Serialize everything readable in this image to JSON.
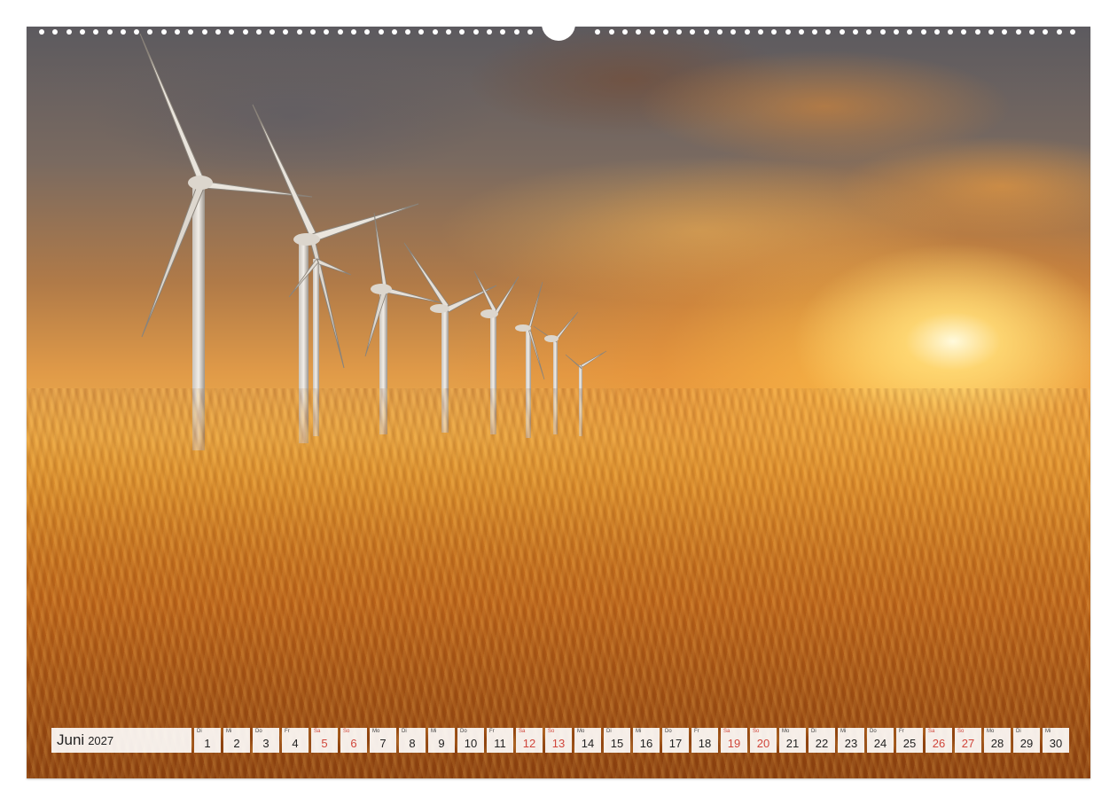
{
  "calendar": {
    "month": "Juni",
    "year": "2027",
    "days": [
      {
        "wd": "Di",
        "num": "1",
        "weekend": false
      },
      {
        "wd": "Mi",
        "num": "2",
        "weekend": false
      },
      {
        "wd": "Do",
        "num": "3",
        "weekend": false
      },
      {
        "wd": "Fr",
        "num": "4",
        "weekend": false
      },
      {
        "wd": "Sa",
        "num": "5",
        "weekend": true
      },
      {
        "wd": "So",
        "num": "6",
        "weekend": true
      },
      {
        "wd": "Mo",
        "num": "7",
        "weekend": false
      },
      {
        "wd": "Di",
        "num": "8",
        "weekend": false
      },
      {
        "wd": "Mi",
        "num": "9",
        "weekend": false
      },
      {
        "wd": "Do",
        "num": "10",
        "weekend": false
      },
      {
        "wd": "Fr",
        "num": "11",
        "weekend": false
      },
      {
        "wd": "Sa",
        "num": "12",
        "weekend": true
      },
      {
        "wd": "So",
        "num": "13",
        "weekend": true
      },
      {
        "wd": "Mo",
        "num": "14",
        "weekend": false
      },
      {
        "wd": "Di",
        "num": "15",
        "weekend": false
      },
      {
        "wd": "Mi",
        "num": "16",
        "weekend": false
      },
      {
        "wd": "Do",
        "num": "17",
        "weekend": false
      },
      {
        "wd": "Fr",
        "num": "18",
        "weekend": false
      },
      {
        "wd": "Sa",
        "num": "19",
        "weekend": true
      },
      {
        "wd": "So",
        "num": "20",
        "weekend": true
      },
      {
        "wd": "Mo",
        "num": "21",
        "weekend": false
      },
      {
        "wd": "Di",
        "num": "22",
        "weekend": false
      },
      {
        "wd": "Mi",
        "num": "23",
        "weekend": false
      },
      {
        "wd": "Do",
        "num": "24",
        "weekend": false
      },
      {
        "wd": "Fr",
        "num": "25",
        "weekend": false
      },
      {
        "wd": "Sa",
        "num": "26",
        "weekend": true
      },
      {
        "wd": "So",
        "num": "27",
        "weekend": true
      },
      {
        "wd": "Mo",
        "num": "28",
        "weekend": false
      },
      {
        "wd": "Di",
        "num": "29",
        "weekend": false
      },
      {
        "wd": "Mi",
        "num": "30",
        "weekend": false
      }
    ]
  },
  "colors": {
    "weekend_text": "#d0453a",
    "cell_background": "#ffffff"
  }
}
